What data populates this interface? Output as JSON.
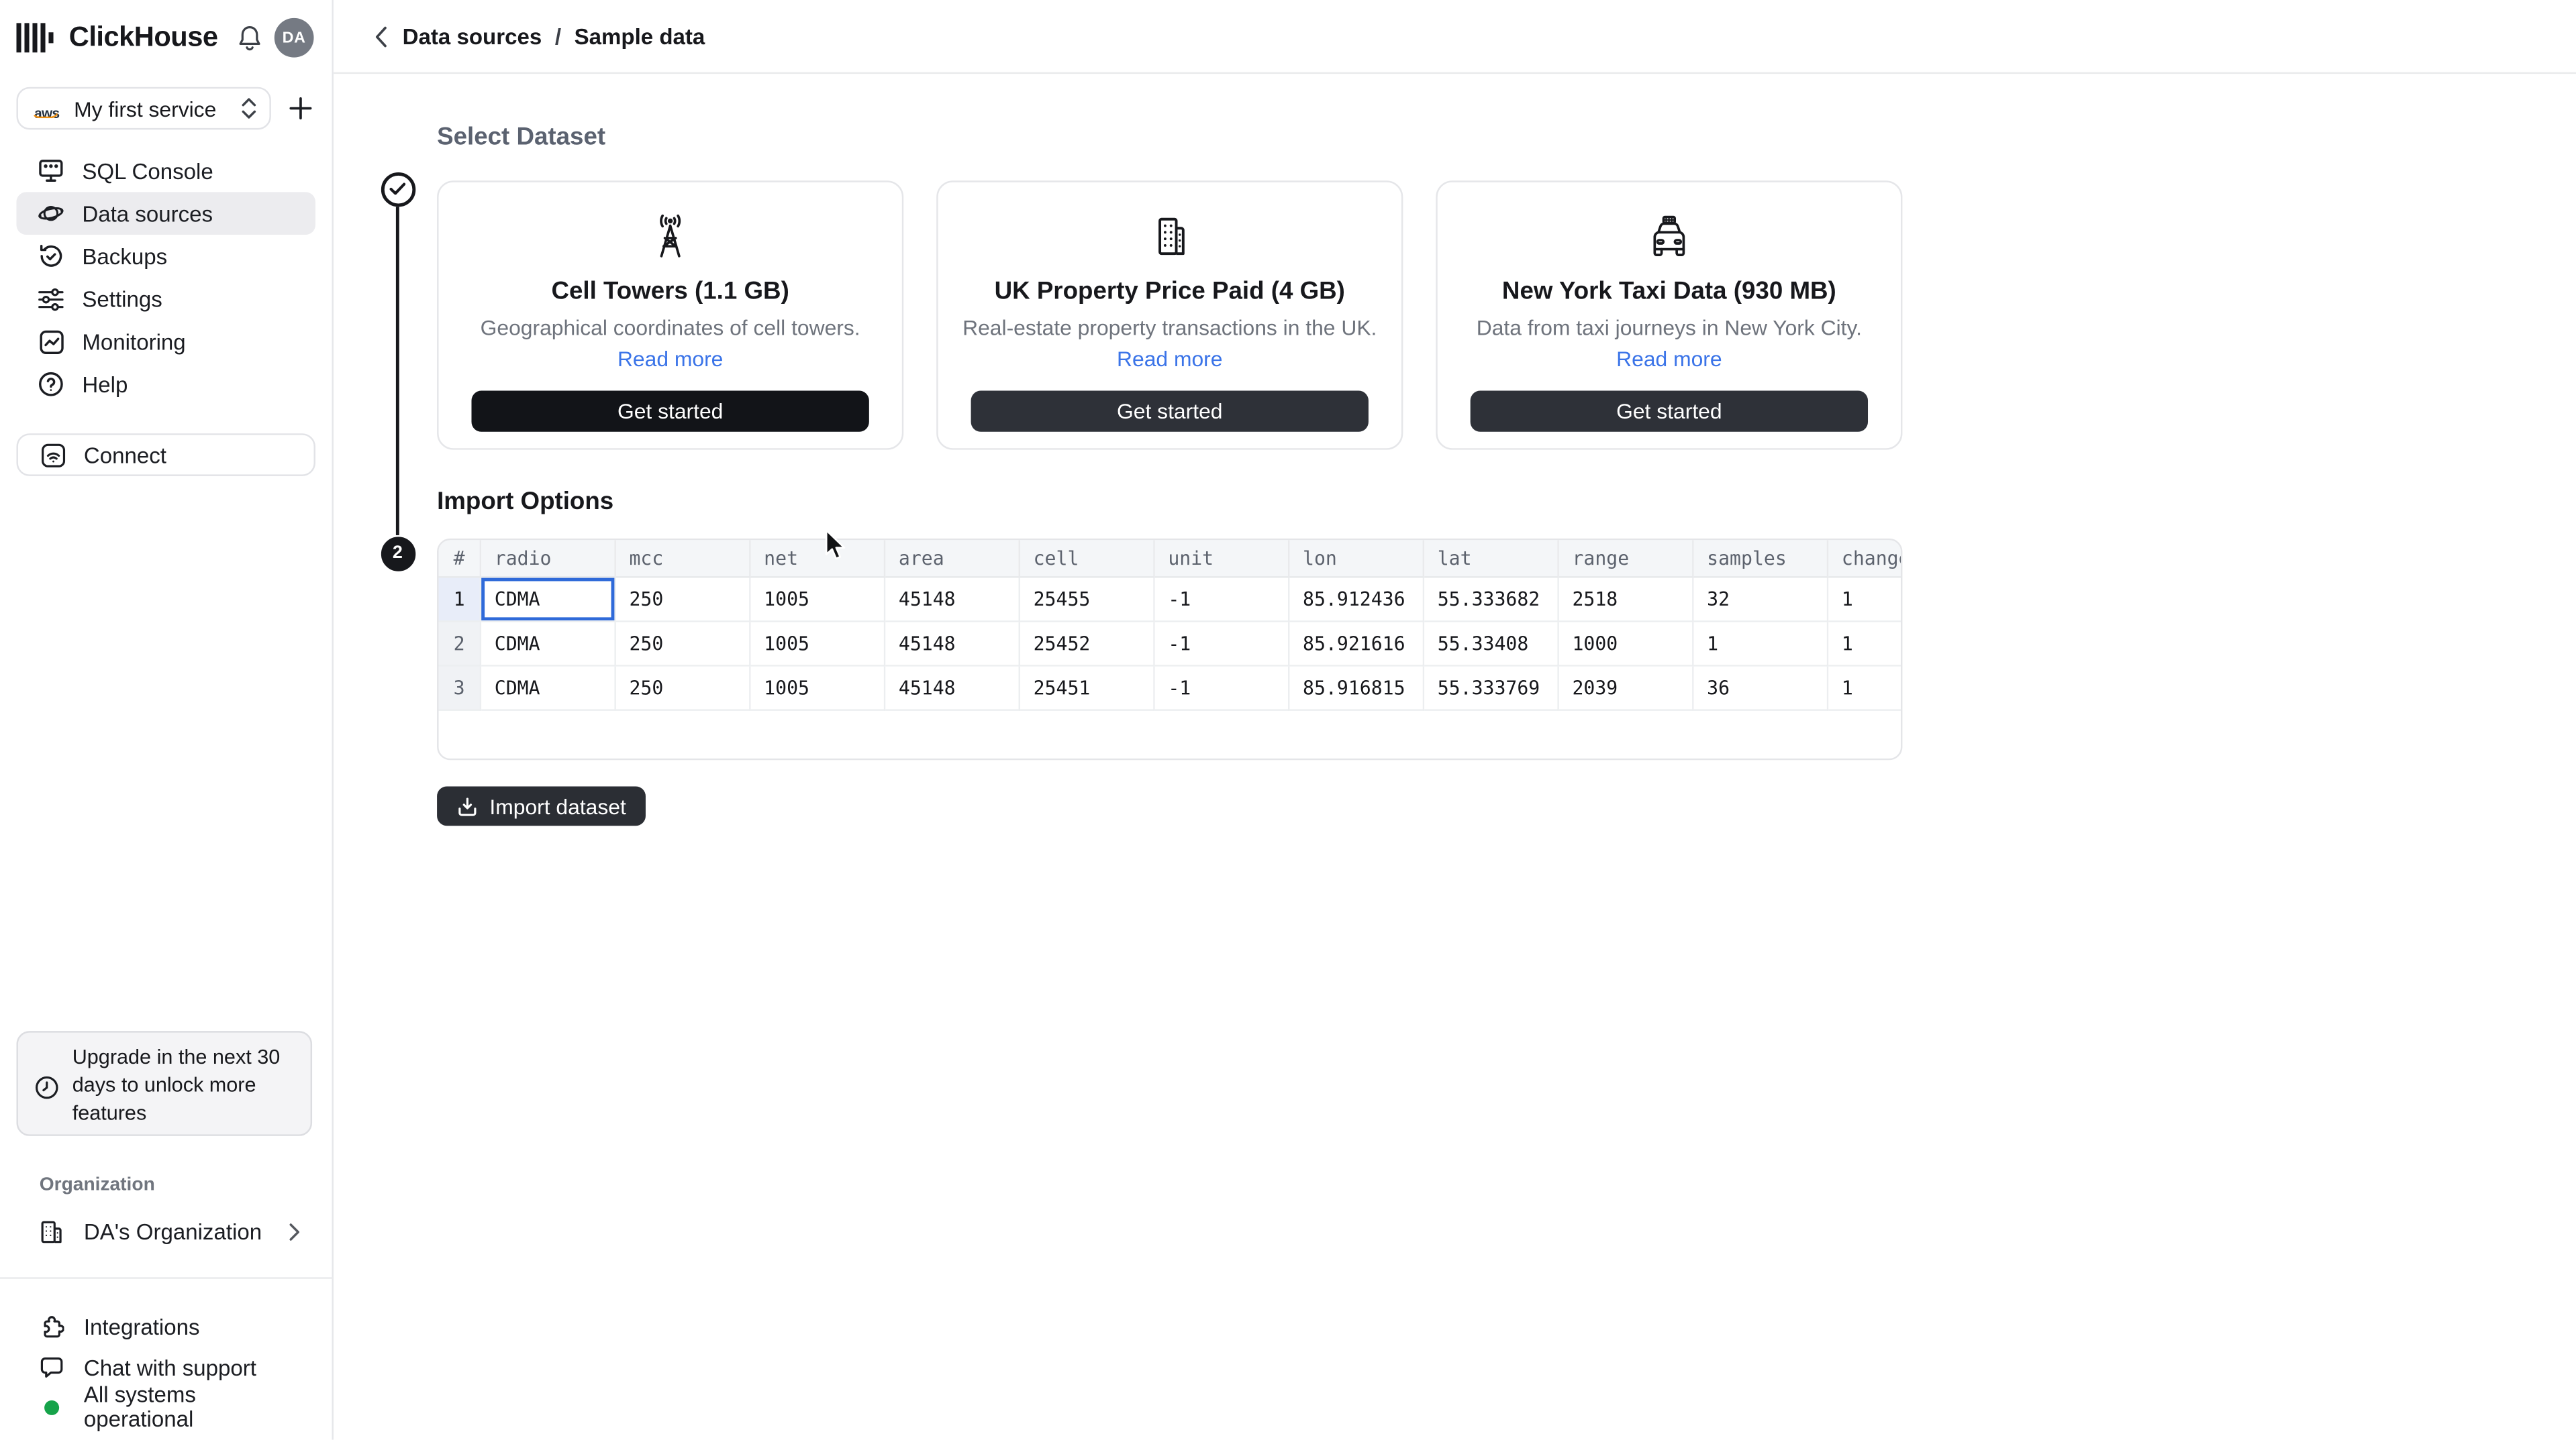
{
  "app": {
    "brand": "ClickHouse",
    "avatar_initials": "DA"
  },
  "service_selector": {
    "name": "My first service",
    "provider": "aws"
  },
  "sidebar": {
    "nav": [
      {
        "label": "SQL Console"
      },
      {
        "label": "Data sources",
        "active": true
      },
      {
        "label": "Backups"
      },
      {
        "label": "Settings"
      },
      {
        "label": "Monitoring"
      },
      {
        "label": "Help"
      }
    ],
    "connect_label": "Connect",
    "upgrade_notice": "Upgrade in the next 30 days to unlock more features",
    "organization_section_label": "Organization",
    "organization_name": "DA's Organization",
    "footer": [
      {
        "label": "Integrations"
      },
      {
        "label": "Chat with support"
      },
      {
        "label": "All systems operational"
      }
    ]
  },
  "breadcrumb": {
    "items": [
      "Data sources",
      "Sample data"
    ],
    "separator": "/"
  },
  "steps": [
    {
      "state": "complete",
      "title": "Select Dataset"
    },
    {
      "number": "2",
      "title": "Import Options"
    }
  ],
  "datasets": [
    {
      "icon": "cell-tower-icon",
      "title": "Cell Towers (1.1 GB)",
      "description": "Geographical coordinates of cell towers.",
      "link_label": "Read more",
      "cta_label": "Get started"
    },
    {
      "icon": "building-icon",
      "title": "UK Property Price Paid (4 GB)",
      "description": "Real-estate property transactions in the UK.",
      "link_label": "Read more",
      "cta_label": "Get started"
    },
    {
      "icon": "taxi-icon",
      "title": "New York Taxi Data (930 MB)",
      "description": "Data from taxi journeys in New York City.",
      "link_label": "Read more",
      "cta_label": "Get started"
    }
  ],
  "preview_table": {
    "columns": [
      "#",
      "radio",
      "mcc",
      "net",
      "area",
      "cell",
      "unit",
      "lon",
      "lat",
      "range",
      "samples",
      "changeable"
    ],
    "rows": [
      [
        "1",
        "CDMA",
        "250",
        "1005",
        "45148",
        "25455",
        "-1",
        "85.912436",
        "55.333682",
        "2518",
        "32",
        "1"
      ],
      [
        "2",
        "CDMA",
        "250",
        "1005",
        "45148",
        "25452",
        "-1",
        "85.921616",
        "55.33408",
        "1000",
        "1",
        "1"
      ],
      [
        "3",
        "CDMA",
        "250",
        "1005",
        "45148",
        "25451",
        "-1",
        "85.916815",
        "55.333769",
        "2039",
        "36",
        "1"
      ]
    ],
    "selected_cell": {
      "row_index": 0,
      "column": "radio"
    }
  },
  "import_button": {
    "label": "Import dataset"
  },
  "colors": {
    "accent_blue": "#2f6ad9",
    "link_blue": "#3b74e8",
    "status_green": "#16a34a",
    "dark_button": "#2b2e34"
  }
}
